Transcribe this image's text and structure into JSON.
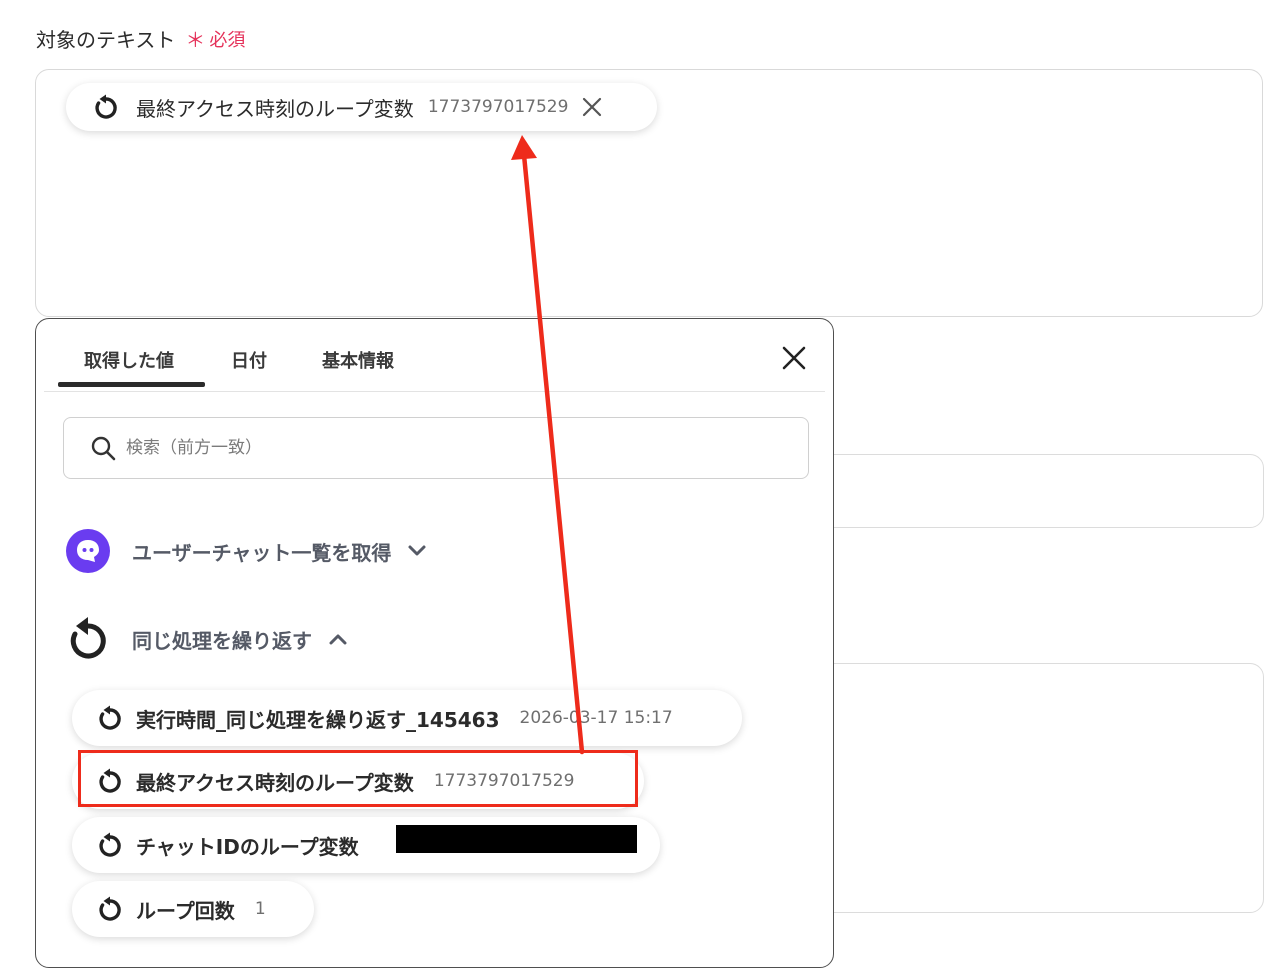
{
  "field": {
    "label": "対象のテキスト",
    "required_mark": "＊",
    "required_text": "必須"
  },
  "selected_chip": {
    "name": "最終アクセス時刻のループ変数",
    "value": "1773797017529",
    "icon": "loop-icon",
    "remove_icon": "close-icon"
  },
  "panel": {
    "tabs": [
      {
        "label": "取得した値",
        "active": true
      },
      {
        "label": "日付",
        "active": false
      },
      {
        "label": "基本情報",
        "active": false
      }
    ],
    "close_icon": "close-icon",
    "search": {
      "placeholder": "検索（前方一致）",
      "value": "",
      "icon": "search-icon"
    },
    "groups": [
      {
        "title": "ユーザーチャット一覧を取得",
        "icon": "chat-app-icon",
        "expanded": false
      },
      {
        "title": "同じ処理を繰り返す",
        "icon": "loop-icon",
        "expanded": true
      }
    ],
    "items": [
      {
        "name": "実行時間_同じ処理を繰り返す_145463",
        "value": "2026-03-17 15:17"
      },
      {
        "name": "最終アクセス時刻のループ変数",
        "value": "1773797017529",
        "highlighted": true
      },
      {
        "name": "チャットIDのループ変数",
        "value": "",
        "redacted": true
      },
      {
        "name": "ループ回数",
        "value": "1"
      }
    ]
  },
  "colors": {
    "required": "#e5325a",
    "highlight": "#ee2b1b",
    "avatar": "#6a3cf0",
    "text": "#2b2b2b"
  }
}
